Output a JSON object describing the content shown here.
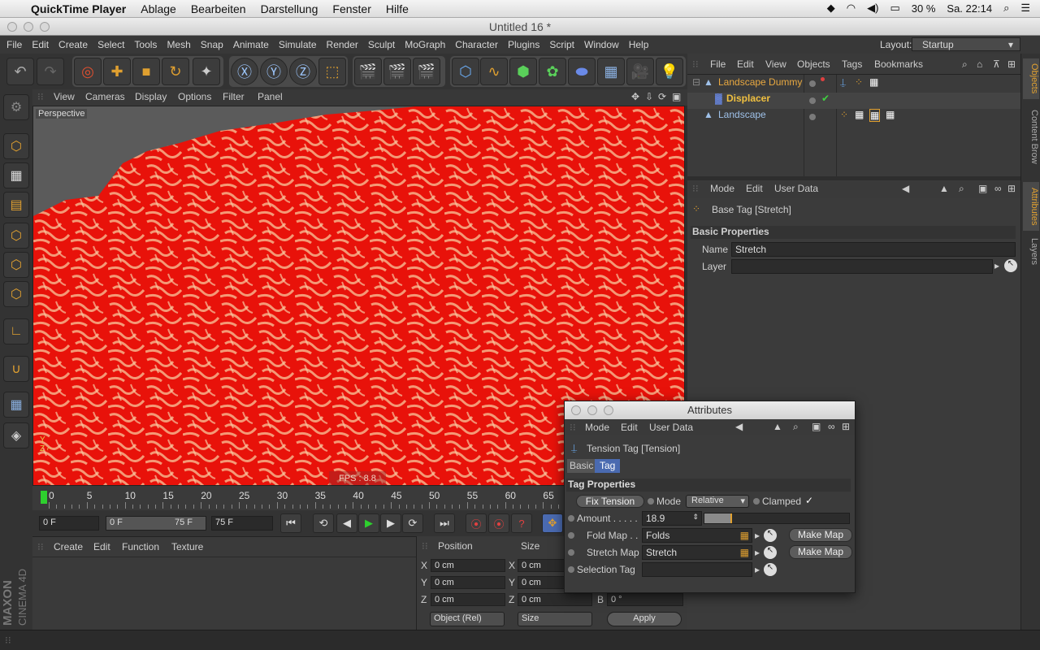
{
  "macmenu": {
    "app": "QuickTime Player",
    "items": [
      "Ablage",
      "Bearbeiten",
      "Darstellung",
      "Fenster",
      "Hilfe"
    ],
    "battery": "30 %",
    "clock": "Sa. 22:14"
  },
  "window": {
    "title": "Untitled 16 *"
  },
  "c4dmenu": [
    "File",
    "Edit",
    "Create",
    "Select",
    "Tools",
    "Mesh",
    "Snap",
    "Animate",
    "Simulate",
    "Render",
    "Sculpt",
    "MoGraph",
    "Character",
    "Plugins",
    "Script",
    "Window",
    "Help"
  ],
  "layout": {
    "label": "Layout:",
    "value": "Startup"
  },
  "viewport": {
    "menu": [
      "View",
      "Cameras",
      "Display",
      "Options",
      "Filter",
      "Panel"
    ],
    "label": "Perspective",
    "fps": "FPS : 8.8",
    "terrain_color": "#e8120a"
  },
  "timeline": {
    "ticks": [
      "0",
      "5",
      "10",
      "15",
      "20",
      "25",
      "30",
      "35",
      "40",
      "45",
      "50",
      "55",
      "60",
      "65"
    ],
    "start": "0 F",
    "range_start": "0 F",
    "range_end": "75 F",
    "end": "75 F"
  },
  "material": {
    "menu": [
      "Create",
      "Edit",
      "Function",
      "Texture"
    ]
  },
  "coords": {
    "headers": {
      "position": "Position",
      "size": "Size"
    },
    "rows": [
      {
        "axis": "X",
        "pos": "0 cm",
        "axis2": "X",
        "size": "0 cm"
      },
      {
        "axis": "Y",
        "pos": "0 cm",
        "axis2": "Y",
        "size": "0 cm"
      },
      {
        "axis": "Z",
        "pos": "0 cm",
        "axis2": "Z",
        "size": "0 cm",
        "axis3": "B",
        "rot": "0 °"
      }
    ],
    "mode": "Object (Rel)",
    "sizemode": "Size",
    "apply": "Apply"
  },
  "objects": {
    "menu": [
      "File",
      "Edit",
      "View",
      "Objects",
      "Tags",
      "Bookmarks"
    ],
    "items": [
      {
        "name": "Landscape Dummy",
        "color": "#e8a840"
      },
      {
        "name": "Displacer",
        "color": "#f0c040"
      },
      {
        "name": "Landscape",
        "color": "#9ec0e8"
      }
    ]
  },
  "attributes": {
    "menu": [
      "Mode",
      "Edit",
      "User Data"
    ],
    "header": "Base Tag [Stretch]",
    "section": "Basic Properties",
    "name_label": "Name",
    "name_value": "Stretch",
    "layer_label": "Layer"
  },
  "sidetabs": [
    "Objects",
    "Content Brow",
    "Attributes",
    "Layers"
  ],
  "floatwin": {
    "title": "Attributes",
    "menu": [
      "Mode",
      "Edit",
      "User Data"
    ],
    "header": "Tension Tag [Tension]",
    "tabs": [
      "Basic",
      "Tag"
    ],
    "section": "Tag Properties",
    "fix_tension": "Fix Tension",
    "mode_label": "Mode",
    "mode_value": "Relative",
    "clamped_label": "Clamped",
    "clamped_check": "✓",
    "amount_label": "Amount . . . . .",
    "amount_value": "18.9",
    "amount_fraction": 0.19,
    "foldmap_label": "Fold Map . .",
    "foldmap_value": "Folds",
    "stretchmap_label": "Stretch Map",
    "stretchmap_value": "Stretch",
    "selection_label": "Selection Tag",
    "makemap": "Make Map"
  },
  "brand": {
    "maxon": "MAXON",
    "cinema": "CINEMA 4D"
  }
}
